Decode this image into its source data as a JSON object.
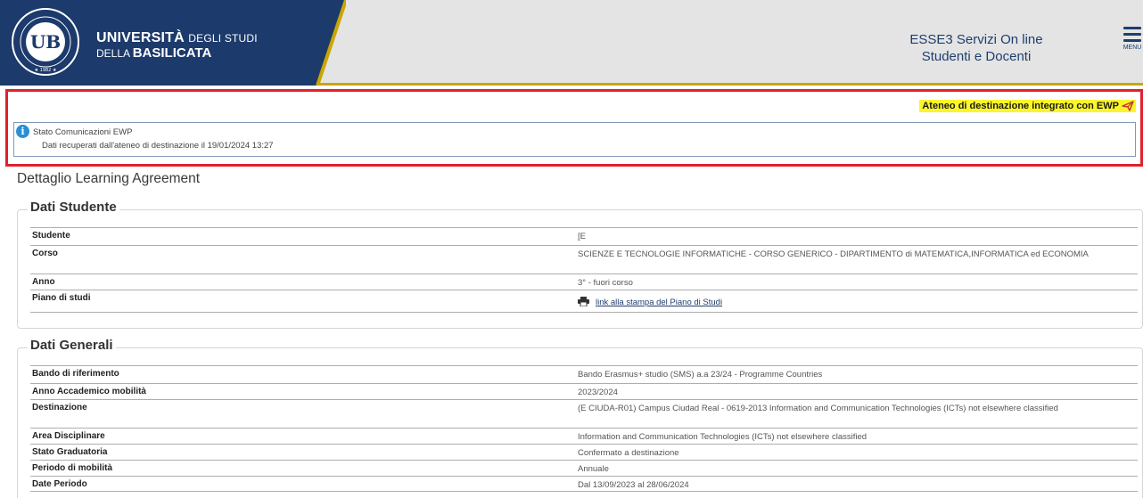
{
  "header": {
    "university_bold": "UNIVERSITÀ",
    "university_thin": "DEGLI STUDI",
    "line2_thin": "DELLA",
    "line2_bold": "BASILICATA",
    "portal_line1": "ESSE3 Servizi On line",
    "portal_line2": "Studenti e Docenti",
    "menu_label": "MENU",
    "seal_text": "UNIVERSITÀ DEGLI STUDI DELLA BASILICATA",
    "seal_year": "1982",
    "brand_color": "#1c3a6b",
    "accent_color": "#c9a600"
  },
  "ewp": {
    "integrated_label": "Ateneo di destinazione integrato con EWP",
    "status_title": "Stato Comunicazioni EWP",
    "status_detail": "Dati recuperati dall'ateneo di destinazione il 19/01/2024 13:27",
    "highlight_color": "#e0212b",
    "badge_color": "#fbf52a"
  },
  "page_title": "Dettaglio Learning Agreement",
  "dati_studente": {
    "legend": "Dati Studente",
    "rows": [
      {
        "label": "Studente",
        "value": "[E"
      },
      {
        "label": "Corso",
        "value": "SCIENZE E TECNOLOGIE INFORMATICHE - CORSO GENERICO - DIPARTIMENTO di MATEMATICA,INFORMATICA ed ECONOMIA"
      },
      {
        "label": "Anno",
        "value": "3° - fuori corso"
      },
      {
        "label": "Piano di studi",
        "value": "link alla stampa del Piano di Studi"
      }
    ]
  },
  "dati_generali": {
    "legend": "Dati Generali",
    "rows": [
      {
        "label": "Bando di riferimento",
        "value": "Bando Erasmus+ studio (SMS) a.a 23/24 - Programme Countries"
      },
      {
        "label": "Anno Accademico mobilità",
        "value": "2023/2024"
      },
      {
        "label": "Destinazione",
        "value": "(E CIUDA-R01) Campus Ciudad Real - 0619-2013 Information and Communication Technologies (ICTs) not elsewhere classified"
      },
      {
        "label": "Area Disciplinare",
        "value": "Information and Communication Technologies (ICTs) not elsewhere classified"
      },
      {
        "label": "Stato Graduatoria",
        "value": "Confermato a destinazione"
      },
      {
        "label": "Periodo di mobilità",
        "value": "Annuale"
      },
      {
        "label": "Date Periodo",
        "value": "Dal 13/09/2023 al 28/06/2024"
      }
    ]
  }
}
